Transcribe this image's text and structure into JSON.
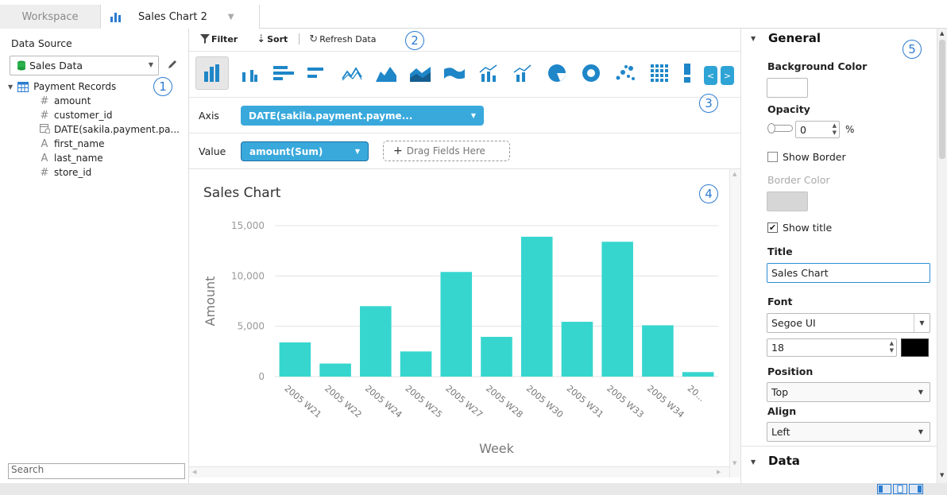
{
  "tabs": [
    {
      "label": "Workspace"
    },
    {
      "label": "Sales Chart 2"
    }
  ],
  "left": {
    "data_source_label": "Data Source",
    "data_source_value": "Sales Data",
    "table_name": "Payment Records",
    "fields": [
      {
        "icon": "#",
        "name": "amount"
      },
      {
        "icon": "#",
        "name": "customer_id"
      },
      {
        "icon": "date",
        "name": "DATE(sakila.payment.pa..."
      },
      {
        "icon": "A",
        "name": "first_name"
      },
      {
        "icon": "A",
        "name": "last_name"
      },
      {
        "icon": "#",
        "name": "store_id"
      }
    ],
    "search_placeholder": "Search"
  },
  "toolbar": {
    "filter": "Filter",
    "sort": "Sort",
    "refresh": "Refresh Data"
  },
  "shelves": {
    "axis_label": "Axis",
    "axis_field": "DATE(sakila.payment.payme...",
    "value_label": "Value",
    "value_field": "amount(Sum)",
    "drag_hint": "Drag Fields Here"
  },
  "callouts": [
    "1",
    "2",
    "3",
    "4",
    "5"
  ],
  "chart_data": {
    "type": "bar",
    "title": "Sales Chart",
    "xlabel": "Week",
    "ylabel": "Amount",
    "categories": [
      "2005 W21",
      "2005 W22",
      "2005 W24",
      "2005 W25",
      "2005 W27",
      "2005 W28",
      "2005 W30",
      "2005 W31",
      "2005 W33",
      "2005 W34",
      "20..."
    ],
    "values": [
      3400,
      1300,
      7000,
      2500,
      10400,
      3950,
      13900,
      5450,
      13400,
      5100,
      450
    ],
    "yticks": [
      "0",
      "5,000",
      "10,000",
      "15,000"
    ],
    "ylim": [
      0,
      15000
    ],
    "grid": true,
    "bar_color": "#36d6cf"
  },
  "properties": {
    "general_header": "General",
    "bg_color_label": "Background Color",
    "opacity_label": "Opacity",
    "opacity_value": "0",
    "percent": "%",
    "show_border_label": "Show Border",
    "border_color_label": "Border Color",
    "show_title_label": "Show title",
    "title_label": "Title",
    "title_value": "Sales Chart",
    "font_label": "Font",
    "font_value": "Segoe UI",
    "font_size": "18",
    "position_label": "Position",
    "position_value": "Top",
    "align_label": "Align",
    "align_value": "Left",
    "data_header": "Data",
    "check_mark": "✔"
  },
  "colors": {
    "accent": "#39a9dc",
    "bar": "#36d6cf",
    "callout": "#2b7bd0"
  }
}
